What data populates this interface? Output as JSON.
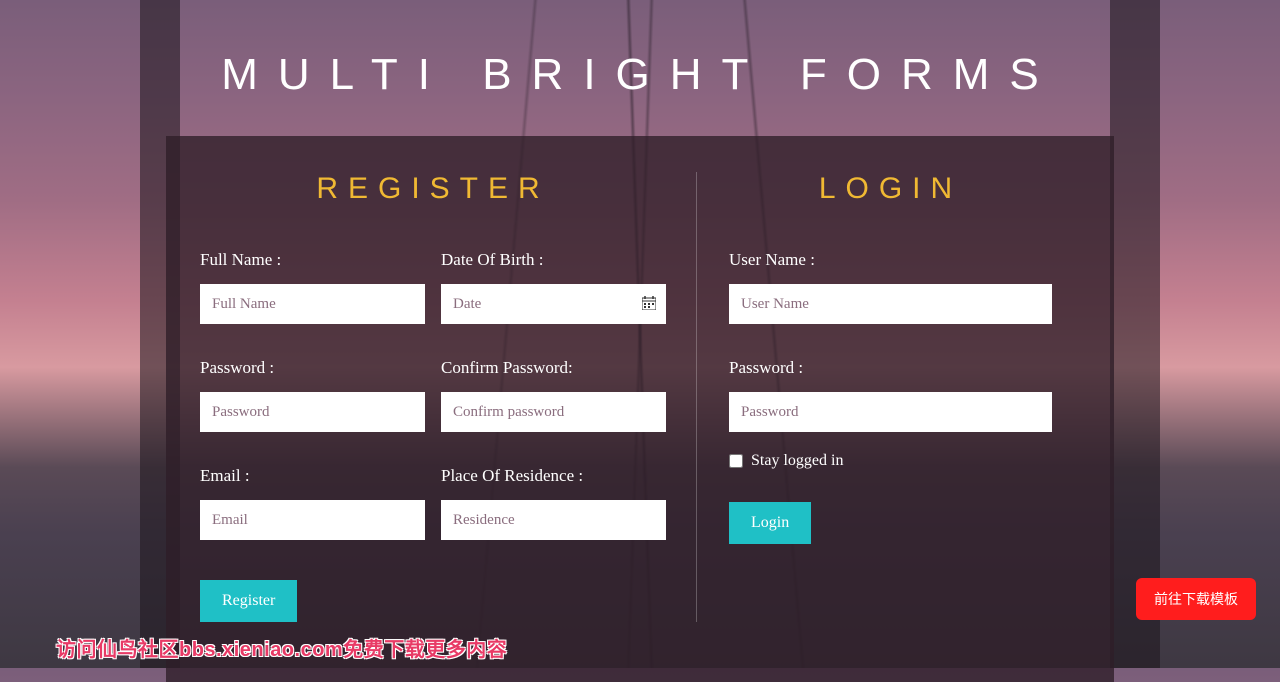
{
  "page_title": "Multi Bright Forms",
  "register": {
    "title": "Register",
    "full_name_label": "Full Name :",
    "full_name_placeholder": "Full Name",
    "dob_label": "Date Of Birth :",
    "dob_placeholder": "Date",
    "password_label": "Password :",
    "password_placeholder": "Password",
    "confirm_label": "Confirm Password:",
    "confirm_placeholder": "Confirm password",
    "email_label": "Email :",
    "email_placeholder": "Email",
    "residence_label": "Place Of Residence :",
    "residence_placeholder": "Residence",
    "button": "Register"
  },
  "login": {
    "title": "Login",
    "username_label": "User Name :",
    "username_placeholder": "User Name",
    "password_label": "Password :",
    "password_placeholder": "Password",
    "stay_logged_label": "Stay logged in",
    "button": "Login"
  },
  "fab_label": "前往下载模板",
  "watermark": "访问仙鸟社区bbs.xieniao.com免费下载更多内容"
}
